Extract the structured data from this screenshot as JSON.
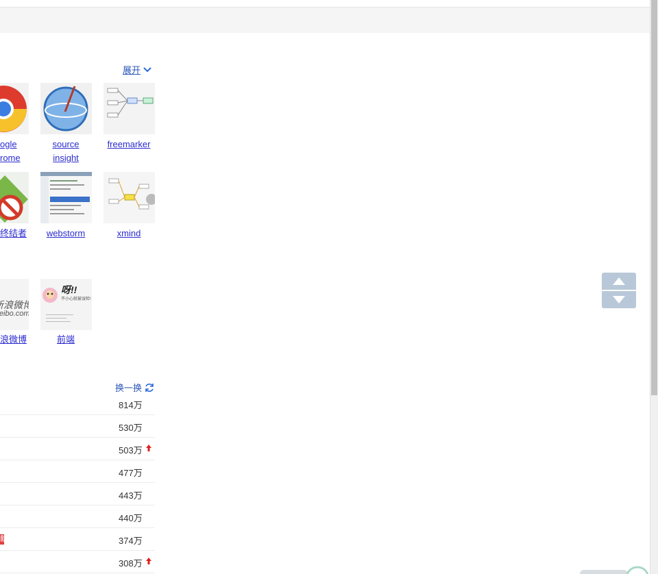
{
  "header": {
    "expand_label": "展开"
  },
  "apps": [
    {
      "name": "ogle\nrome"
    },
    {
      "name": "source\ninsight"
    },
    {
      "name": "freemarker"
    },
    {
      "name": "终结者"
    },
    {
      "name": "webstorm"
    },
    {
      "name": "xmind"
    },
    {
      "name": "浪微博"
    },
    {
      "name": "前端"
    }
  ],
  "tiles": {
    "weibo_text": "新浪微博",
    "weibo_domain": "weibo.com",
    "frontend_title": "呀!!",
    "frontend_sub": "不小心就被误检!"
  },
  "trending": {
    "refresh_label": "换一换",
    "rows": [
      {
        "count": "814万",
        "up": false,
        "new_tag": ""
      },
      {
        "count": "530万",
        "up": false,
        "new_tag": ""
      },
      {
        "count": "503万",
        "up": true,
        "new_tag": ""
      },
      {
        "count": "477万",
        "up": false,
        "new_tag": ""
      },
      {
        "count": "443万",
        "up": false,
        "new_tag": ""
      },
      {
        "count": "440万",
        "up": false,
        "new_tag": ""
      },
      {
        "count": "374万",
        "up": false,
        "new_tag": "新"
      },
      {
        "count": "308万",
        "up": true,
        "new_tag": ""
      }
    ]
  },
  "colors": {
    "link": "#2a55b8",
    "up_arrow": "#e02020",
    "new_tag": "#e04040",
    "scroll_widget": "#b8c8d8"
  }
}
